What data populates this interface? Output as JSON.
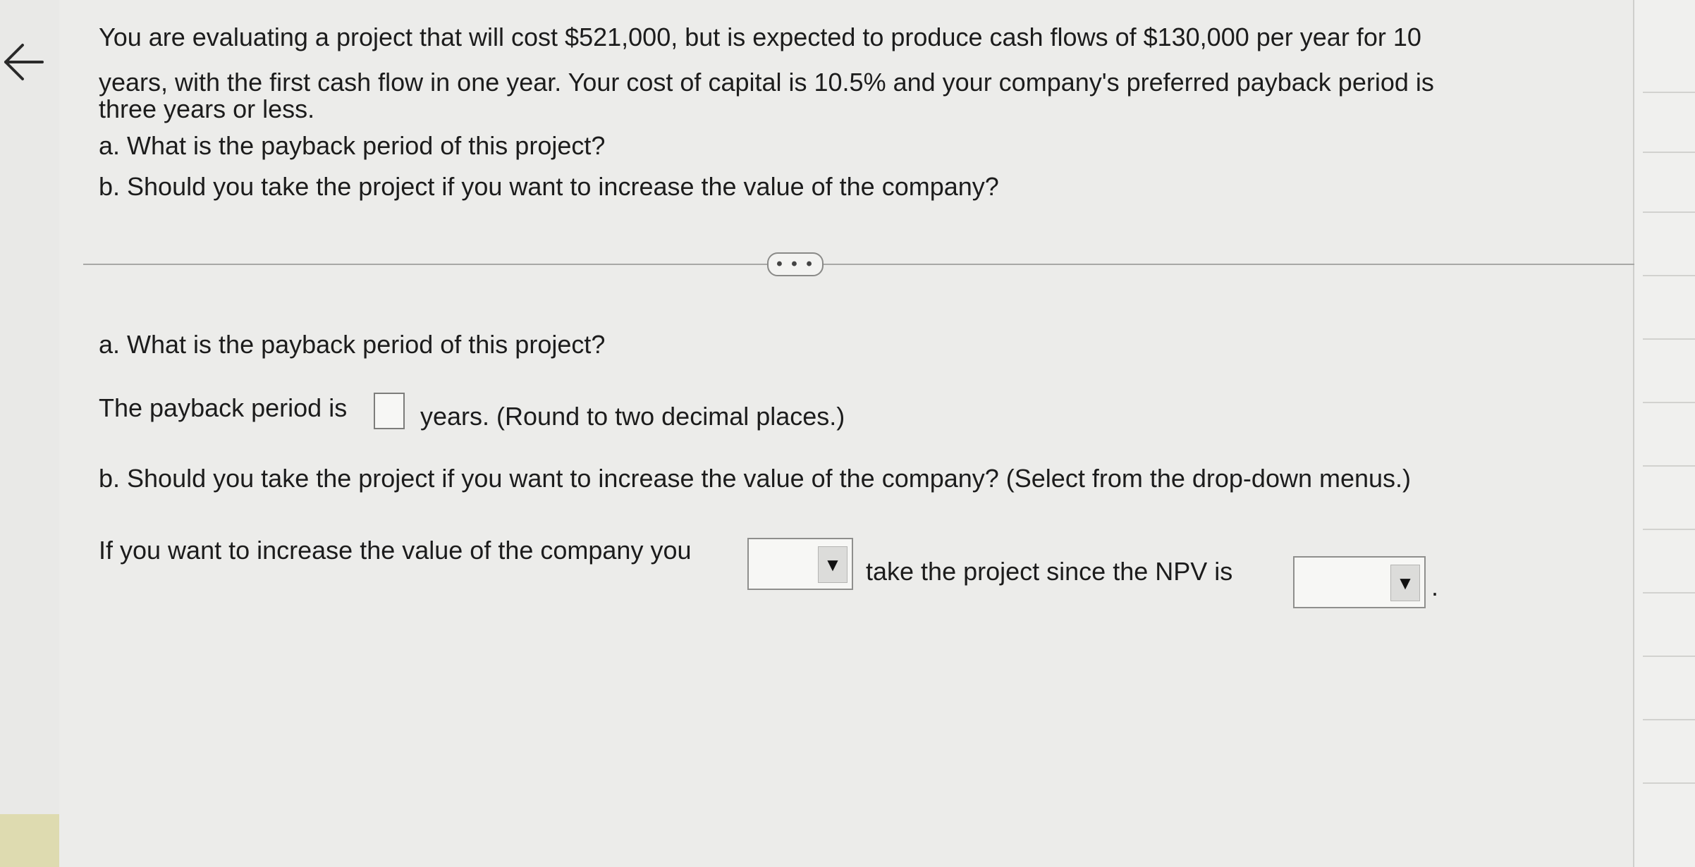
{
  "question": {
    "intro_lines": [
      "You are evaluating a project that will cost $521,000, but is expected to produce cash flows of $130,000 per year for 10",
      "years, with the first cash flow in one year. Your cost of capital is 10.5% and your company's preferred payback period is",
      "three years or less."
    ],
    "part_a": "a. What is the payback period of this project?",
    "part_b": "b. Should you take the project if you want to increase the value of the company?"
  },
  "divider": {
    "more_label": "• • •"
  },
  "answer": {
    "part_a_heading": "a. What is the payback period of this project?",
    "payback_prefix": "The payback period is",
    "payback_value": "",
    "payback_suffix": "years.  (Round to two decimal places.)",
    "part_b_heading": "b. Should you take the project if you want to increase the value of the company?  (Select from the drop-down menus.)",
    "sentence_prefix": "If you want to increase the value of the company you",
    "dropdown_1_value": "",
    "sentence_middle": "take the project since the NPV is",
    "dropdown_2_value": "",
    "sentence_end": "."
  },
  "icons": {
    "back": "back-arrow-icon",
    "dropdown": "triangle-down-icon"
  },
  "colors": {
    "page_background": "#ececea",
    "text": "#1c1c1c"
  }
}
